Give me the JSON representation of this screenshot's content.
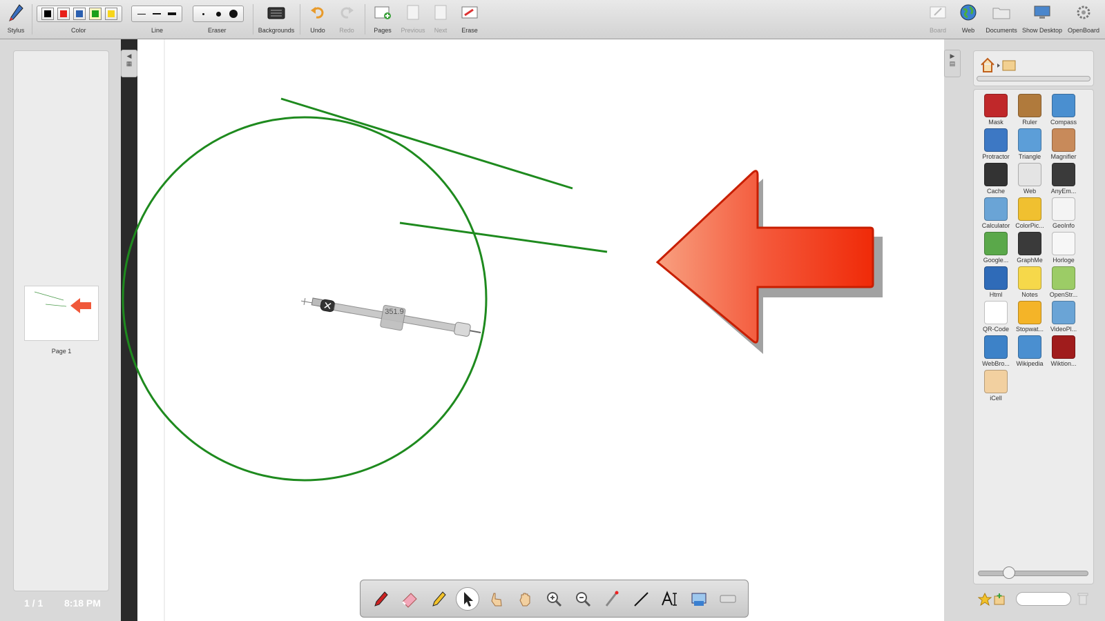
{
  "toolbar": {
    "stylus": "Stylus",
    "color": "Color",
    "line": "Line",
    "eraser": "Eraser",
    "backgrounds": "Backgrounds",
    "undo": "Undo",
    "redo": "Redo",
    "pages": "Pages",
    "previous": "Previous",
    "next": "Next",
    "erase": "Erase",
    "board": "Board",
    "web": "Web",
    "documents": "Documents",
    "show_desktop": "Show Desktop",
    "openboard": "OpenBoard",
    "colors": [
      "#000000",
      "#e8201a",
      "#2a5fb0",
      "#1aa01a",
      "#f7d51c"
    ]
  },
  "pages": {
    "thumb_label": "Page 1",
    "counter": "1 / 1",
    "clock": "8:18 PM"
  },
  "compass": {
    "reading": "351.9"
  },
  "library": {
    "items": [
      {
        "name": "Mask",
        "color": "#c0282a"
      },
      {
        "name": "Ruler",
        "color": "#b07a3c"
      },
      {
        "name": "Compass",
        "color": "#4a8fd0"
      },
      {
        "name": "Protractor",
        "color": "#3d78c4"
      },
      {
        "name": "Triangle",
        "color": "#5c9ed8"
      },
      {
        "name": "Magnifier",
        "color": "#c88a5a"
      },
      {
        "name": "Cache",
        "color": "#333333"
      },
      {
        "name": "Web",
        "color": "#e4e4e4"
      },
      {
        "name": "AnyEm...",
        "color": "#3a3a3a"
      },
      {
        "name": "Calculator",
        "color": "#6aa4d6"
      },
      {
        "name": "ColorPic...",
        "color": "#f0c030"
      },
      {
        "name": "GeoInfo",
        "color": "#f4f4f4"
      },
      {
        "name": "Google...",
        "color": "#5aa84a"
      },
      {
        "name": "GraphMe",
        "color": "#3a3a3a"
      },
      {
        "name": "Horloge",
        "color": "#f7f7f7"
      },
      {
        "name": "Html",
        "color": "#2f6bb8"
      },
      {
        "name": "Notes",
        "color": "#f6d84a"
      },
      {
        "name": "OpenStr...",
        "color": "#9ccc66"
      },
      {
        "name": "QR-Code",
        "color": "#ffffff"
      },
      {
        "name": "Stopwat...",
        "color": "#f4b428"
      },
      {
        "name": "VideoPl...",
        "color": "#6aa4d6"
      },
      {
        "name": "WebBro...",
        "color": "#3d82c8"
      },
      {
        "name": "Wikipedia",
        "color": "#4a8fd0"
      },
      {
        "name": "Wiktion...",
        "color": "#a01c1c"
      },
      {
        "name": "iCell",
        "color": "#f2d0a0"
      }
    ]
  }
}
